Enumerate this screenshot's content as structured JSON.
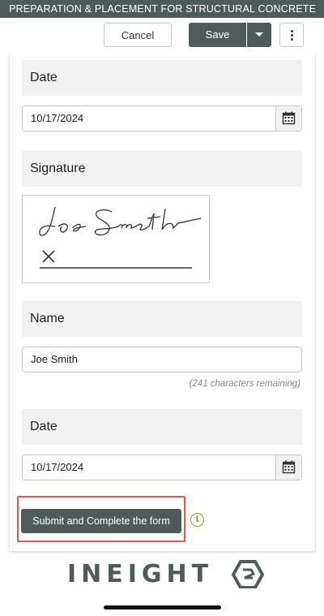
{
  "window": {
    "title": "PREPARATION & PLACEMENT FOR STRUCTURAL CONCRETE"
  },
  "toolbar": {
    "cancel_label": "Cancel",
    "save_label": "Save"
  },
  "form": {
    "date1": {
      "label": "Date",
      "value": "10/17/2024"
    },
    "signature": {
      "label": "Signature"
    },
    "name": {
      "label": "Name",
      "value": "Joe Smith",
      "remaining": "(241 characters remaining)"
    },
    "date2": {
      "label": "Date",
      "value": "10/17/2024"
    },
    "submit_label": "Submit and Complete the form"
  },
  "footer": {
    "logo_text": "INEIGHT"
  },
  "colors": {
    "primary": "#4f5b5a",
    "highlight": "#e05555",
    "info": "#8c9b2a",
    "section_bg": "#f1f1f1"
  },
  "icons": [
    "calendar-icon",
    "chevron-down-icon",
    "more-vertical-icon",
    "info-icon"
  ]
}
